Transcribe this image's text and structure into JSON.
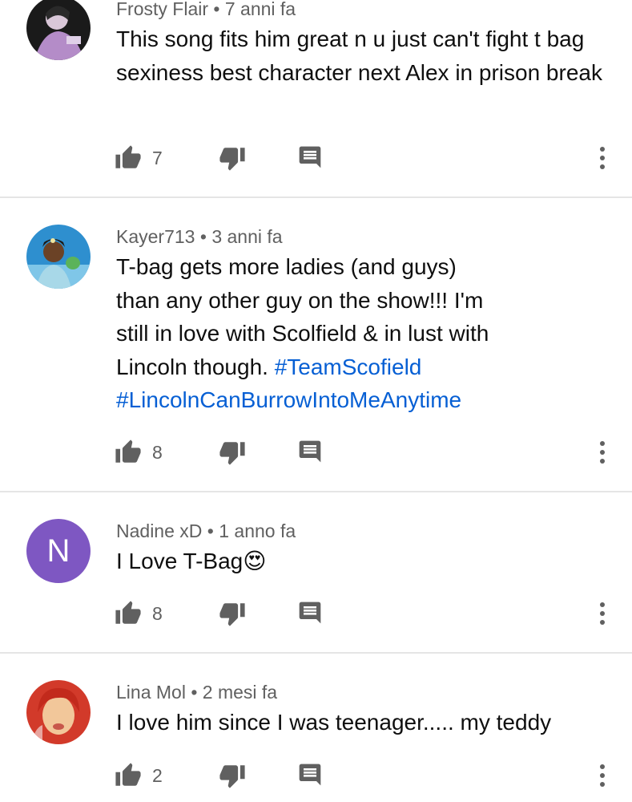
{
  "comments": [
    {
      "author": "Frosty Flair",
      "sep": "•",
      "time": "7 anni fa",
      "text": "This song fits him great n u just can't fight t bag sexiness best character next Alex in prison break",
      "likes": "7",
      "avatar_colors": [
        "#1a1a1a",
        "#b48cc8"
      ]
    },
    {
      "author": "Kayer713",
      "sep": "•",
      "time": "3 anni fa",
      "text": "T-bag gets more ladies (and guys) than any other guy on the show!!! I'm still in love with Scolfield & in lust with Lincoln though.",
      "hashtag1": "#TeamScofield",
      "hashtag2": "#LincolnCanBurrowIntoMeAnytime",
      "likes": "8",
      "avatar_colors": [
        "#2e8fcf",
        "#5bb35a"
      ]
    },
    {
      "author": "Nadine xD",
      "sep": "•",
      "time": "1 anno fa",
      "text": "I Love T-Bag",
      "emoji": "😍",
      "avatar_letter": "N",
      "likes": "8",
      "avatar_colors": [
        "#7e57c2"
      ]
    },
    {
      "author": "Lina Mol",
      "sep": "•",
      "time": "2 mesi fa",
      "text": "I love him since I was teenager..... my teddy",
      "likes": "2",
      "avatar_colors": [
        "#d23a2a",
        "#f2c79a"
      ]
    }
  ],
  "icons": {
    "like": "thumb-up-icon",
    "dislike": "thumb-down-icon",
    "reply": "comment-icon",
    "more": "more-vertical-icon"
  },
  "colors": {
    "meta": "#606060",
    "hashtag": "#065fd4",
    "icon": "#606060",
    "divider": "#e5e5e5"
  }
}
